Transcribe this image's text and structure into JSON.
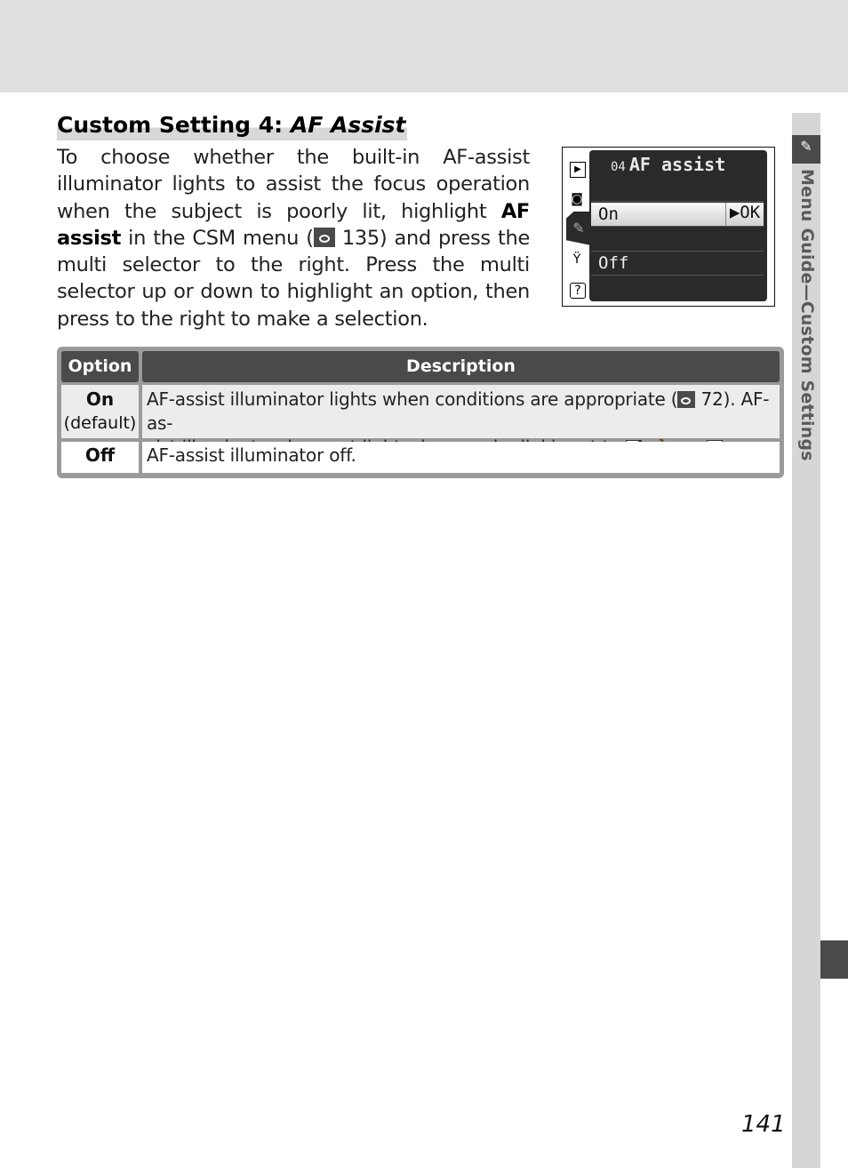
{
  "page": {
    "title_prefix": "Custom Setting 4: ",
    "title_italic": "AF Assist",
    "intro": {
      "part1": "To choose whether the built-in AF-assist illuminator lights to assist the focus operation when the subject is poorly lit, highlight ",
      "bold": "AF assist",
      "part2": " in the CSM menu (",
      "ref_page": " 135) and press the multi selector to the right.  Press the multi selector up or down to highlight an option, then press to the right to make a selection."
    },
    "side_label": "Menu Guide—Custom Settings",
    "page_number": "141"
  },
  "camera_screen": {
    "menu_number": "04",
    "menu_title": "AF assist",
    "options": [
      {
        "label": "On",
        "selected": true,
        "action": "▶OK"
      },
      {
        "label": "Off",
        "selected": false
      }
    ],
    "side_icons": [
      "playback-icon",
      "camera-icon",
      "pencil-icon",
      "wrench-icon",
      "help-icon"
    ]
  },
  "table": {
    "headers": [
      "Option",
      "Description"
    ],
    "rows": [
      {
        "option": "On",
        "option_note": "(default)",
        "desc_line1_a": "AF-assist illuminator lights when conditions are appropriate (",
        "desc_line1_ref": " 72).  AF-as-",
        "desc_line2_a": "sist illuminator does not light when mode dial is set to ",
        "desc_line2_sep1": ", ",
        "desc_line2_sep2": ", or ",
        "desc_line2_end": "."
      },
      {
        "option": "Off",
        "description": "AF-assist illuminator off."
      }
    ]
  }
}
